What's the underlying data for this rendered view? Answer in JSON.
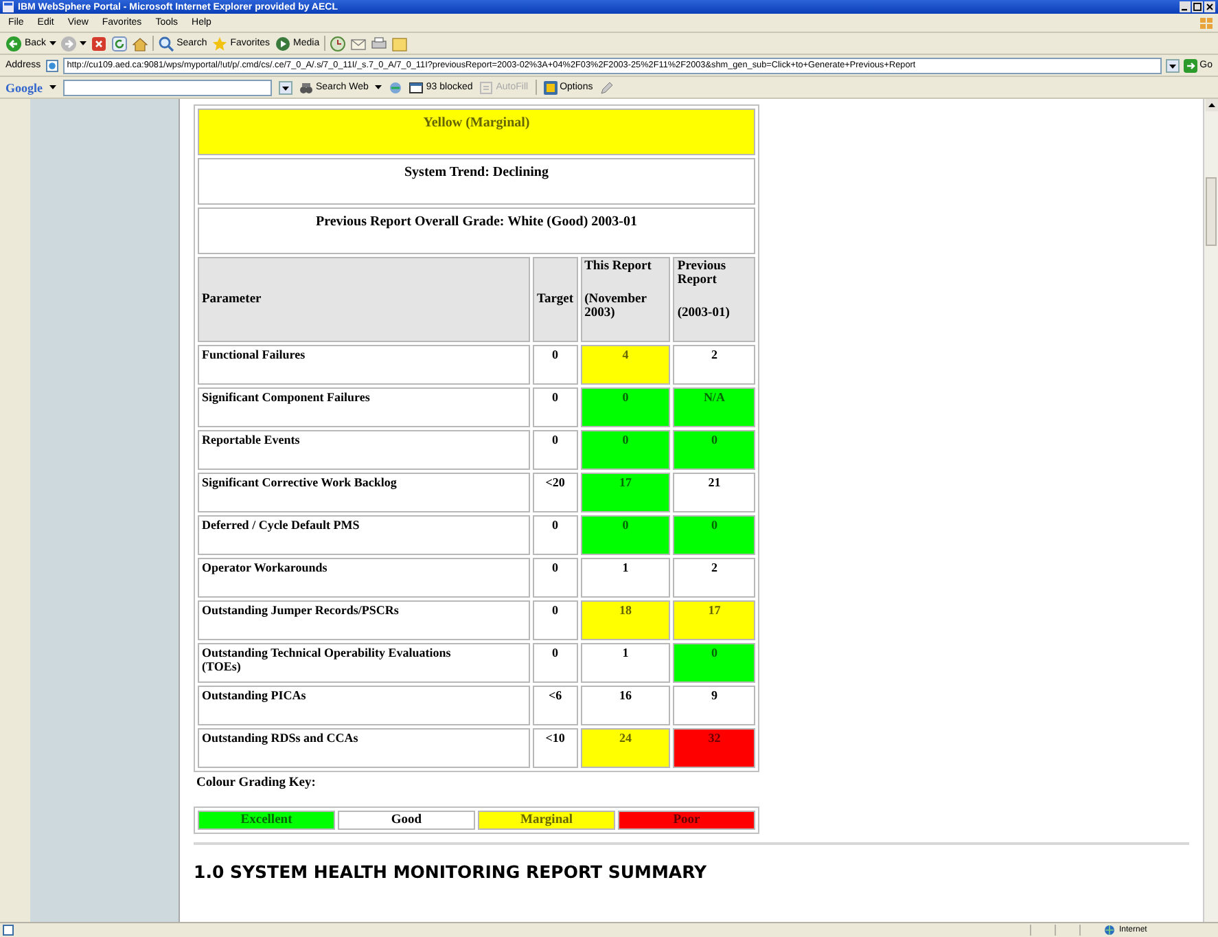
{
  "window": {
    "title": "IBM WebSphere Portal - Microsoft Internet Explorer provided by AECL"
  },
  "menu": [
    "File",
    "Edit",
    "View",
    "Favorites",
    "Tools",
    "Help"
  ],
  "toolbar": [
    {
      "kind": "back",
      "label": "Back"
    },
    {
      "kind": "forward"
    },
    {
      "kind": "stop"
    },
    {
      "kind": "refresh"
    },
    {
      "kind": "home"
    },
    {
      "kind": "search",
      "label": "Search"
    },
    {
      "kind": "favorites",
      "label": "Favorites"
    },
    {
      "kind": "media",
      "label": "Media"
    },
    {
      "kind": "history"
    },
    {
      "kind": "mail"
    },
    {
      "kind": "print"
    },
    {
      "kind": "edit"
    }
  ],
  "address_bar": {
    "label": "Address",
    "url": "http://cu109.aed.ca:9081/wps/myportal/!ut/p/.cmd/cs/.ce/7_0_A/.s/7_0_11I/_s.7_0_A/7_0_11I?previousReport=2003-02%3A+04%2F03%2F2003-25%2F11%2F2003&shm_gen_sub=Click+to+Generate+Previous+Report",
    "go": "Go"
  },
  "google_toolbar": {
    "logo": "Google",
    "search_button": "Search Web",
    "blocked": "93 blocked",
    "autofill": {
      "label": "AutoFill",
      "disabled": true
    },
    "options": "Options"
  },
  "report": {
    "overall": {
      "text": "Yellow (Marginal)",
      "color": "#ffff00"
    },
    "trend": "System Trend: Declining",
    "previous_grade": "Previous Report Overall Grade: White (Good) 2003-01",
    "columns": [
      {
        "label": "Parameter"
      },
      {
        "label": "Target"
      },
      {
        "label": "This Report",
        "sublabel": "(November 2003)"
      },
      {
        "label": "Previous Report",
        "sublabel": "(2003-01)"
      }
    ],
    "rows": [
      {
        "parameter": "Functional Failures",
        "target": "0",
        "this_report": {
          "value": "4",
          "color": "#ffff00"
        },
        "previous_report": {
          "value": "2",
          "color": "#ffffff"
        }
      },
      {
        "parameter": "Significant Component Failures",
        "target": "0",
        "this_report": {
          "value": "0",
          "color": "#00ff00"
        },
        "previous_report": {
          "value": "N/A",
          "color": "#00ff00"
        }
      },
      {
        "parameter": "Reportable Events",
        "target": "0",
        "this_report": {
          "value": "0",
          "color": "#00ff00"
        },
        "previous_report": {
          "value": "0",
          "color": "#00ff00"
        }
      },
      {
        "parameter": "Significant Corrective Work Backlog",
        "target": "<20",
        "this_report": {
          "value": "17",
          "color": "#00ff00"
        },
        "previous_report": {
          "value": "21",
          "color": "#ffffff"
        }
      },
      {
        "parameter": "Deferred / Cycle Default PMS",
        "target": "0",
        "this_report": {
          "value": "0",
          "color": "#00ff00"
        },
        "previous_report": {
          "value": "0",
          "color": "#00ff00"
        }
      },
      {
        "parameter": "Operator Workarounds",
        "target": "0",
        "this_report": {
          "value": "1",
          "color": "#ffffff"
        },
        "previous_report": {
          "value": "2",
          "color": "#ffffff"
        }
      },
      {
        "parameter": "Outstanding Jumper Records/PSCRs",
        "target": "0",
        "this_report": {
          "value": "18",
          "color": "#ffff00"
        },
        "previous_report": {
          "value": "17",
          "color": "#ffff00"
        }
      },
      {
        "parameter": "Outstanding Technical Operability Evaluations (TOEs)",
        "target": "0",
        "this_report": {
          "value": "1",
          "color": "#ffffff"
        },
        "previous_report": {
          "value": "0",
          "color": "#00ff00"
        }
      },
      {
        "parameter": "Outstanding PICAs",
        "target": "<6",
        "this_report": {
          "value": "16",
          "color": "#ffffff"
        },
        "previous_report": {
          "value": "9",
          "color": "#ffffff"
        }
      },
      {
        "parameter": "Outstanding RDSs and CCAs",
        "target": "<10",
        "this_report": {
          "value": "24",
          "color": "#ffff00"
        },
        "previous_report": {
          "value": "32",
          "color": "#ff0000"
        }
      }
    ],
    "key_label": "Colour Grading Key:",
    "key": [
      {
        "label": "Excellent",
        "color": "#00ff00"
      },
      {
        "label": "Good",
        "color": "#ffffff"
      },
      {
        "label": "Marginal",
        "color": "#ffff00"
      },
      {
        "label": "Poor",
        "color": "#ff0000"
      }
    ],
    "section_heading": "1.0 SYSTEM HEALTH MONITORING REPORT SUMMARY"
  },
  "status_bar": {
    "zone": "Internet"
  }
}
